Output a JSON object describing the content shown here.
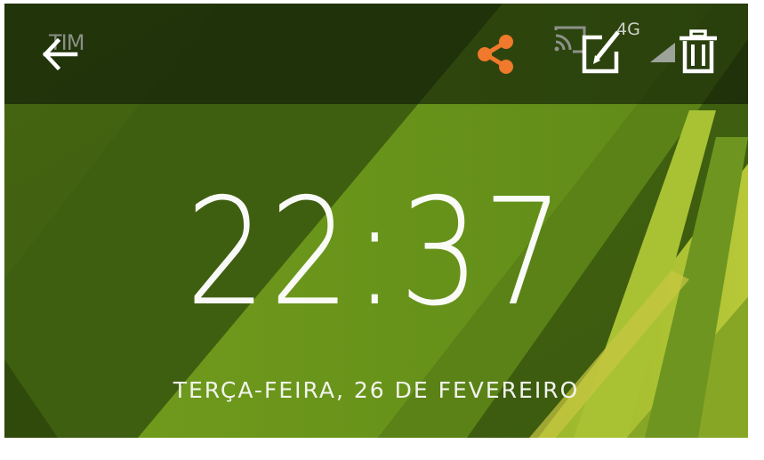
{
  "status_bar": {
    "carrier": "TIM",
    "network": "4G"
  },
  "toolbar": {
    "back_icon": "arrow-left-icon",
    "share_icon": "share-icon",
    "cast_icon": "cast-icon",
    "edit_icon": "edit-icon",
    "signal_icon": "signal-icon",
    "delete_icon": "trash-icon",
    "accent_color": "#f0792b"
  },
  "lockscreen": {
    "time": "22:37",
    "date": "TERÇA-FEIRA, 26 DE FEVEREIRO"
  }
}
